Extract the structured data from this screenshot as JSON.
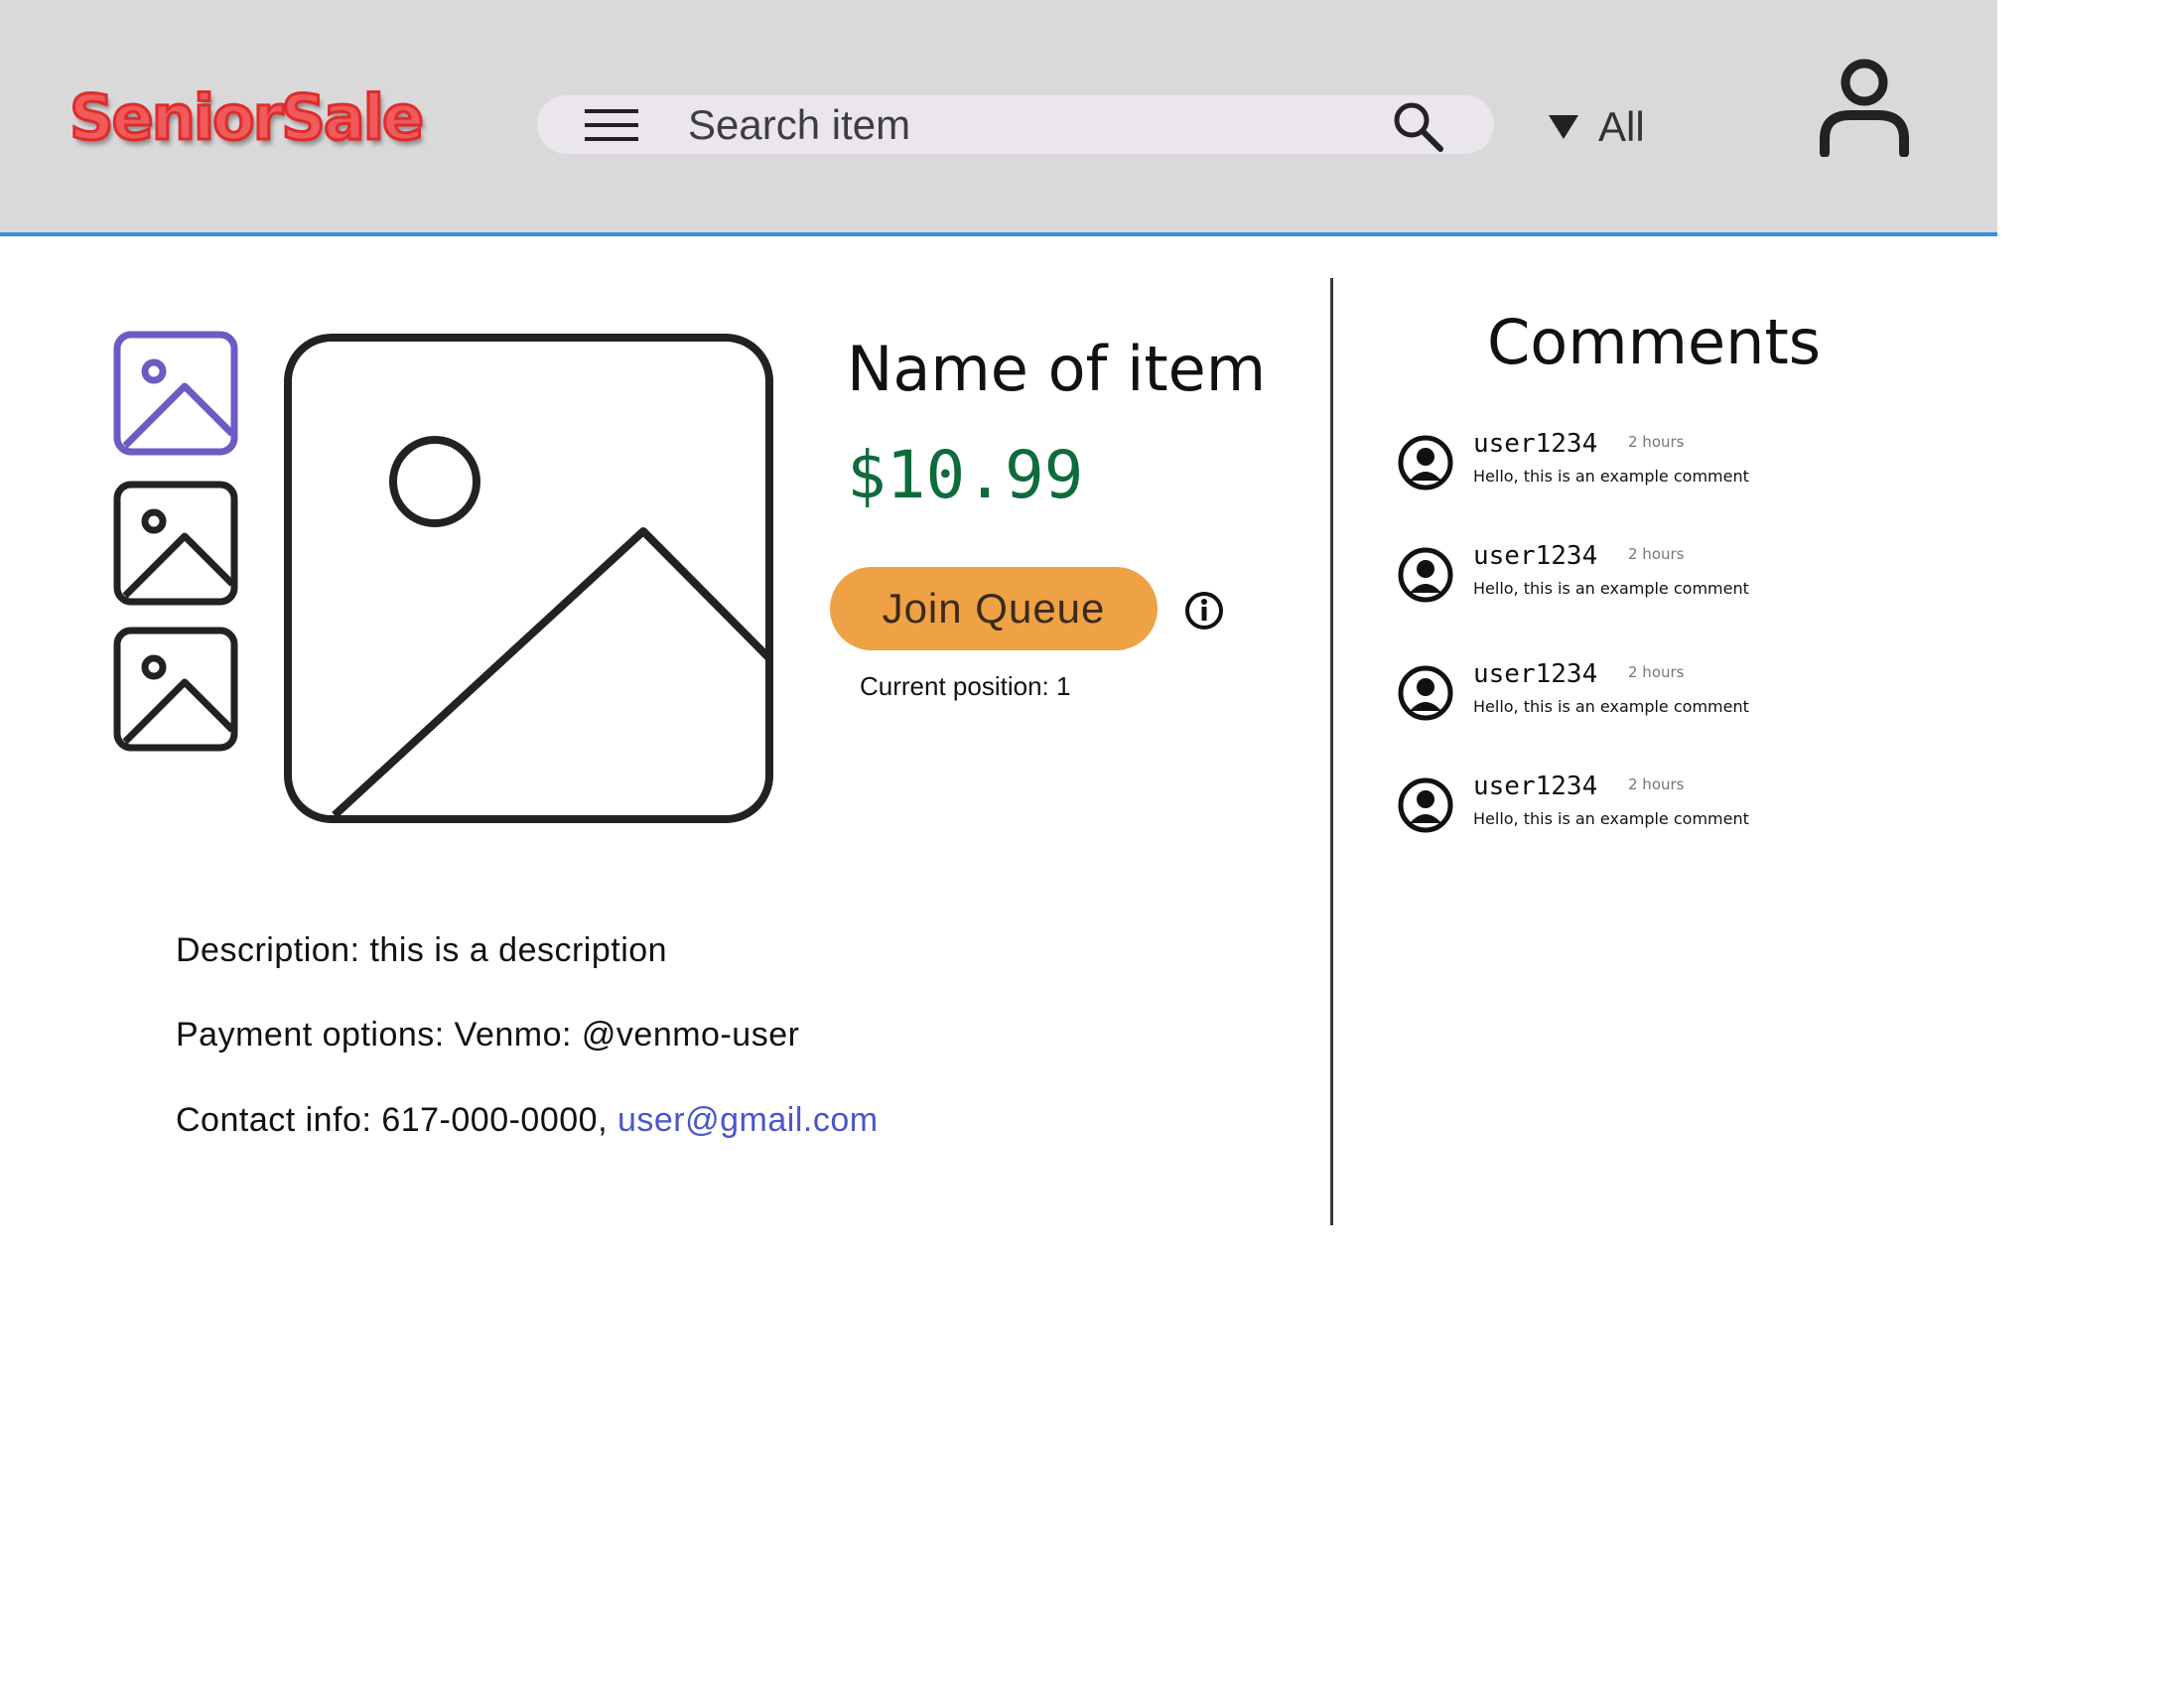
{
  "header": {
    "logo_text": "SeniorSale",
    "search_placeholder": "Search item",
    "filter_label": "All"
  },
  "item": {
    "name": "Name of item",
    "price": "$10.99",
    "join_button_label": "Join Queue",
    "queue_position": "Current position: 1",
    "description": "Description: this is a description",
    "payment": "Payment options: Venmo: @venmo-user",
    "contact_prefix": "Contact info: 617-000-0000, ",
    "contact_email": "user@gmail.com"
  },
  "comments": {
    "title": "Comments",
    "items": [
      {
        "user": "user1234",
        "time": "2 hours",
        "text": "Hello, this is an example comment"
      },
      {
        "user": "user1234",
        "time": "2 hours",
        "text": "Hello, this is an example comment"
      },
      {
        "user": "user1234",
        "time": "2 hours",
        "text": "Hello, this is an example comment"
      },
      {
        "user": "user1234",
        "time": "2 hours",
        "text": "Hello, this is an example comment"
      }
    ]
  },
  "colors": {
    "header_bg": "#d9d9d9",
    "header_border": "#3a8ee0",
    "logo": "#f05a5a",
    "price": "#0e6b3b",
    "join_button": "#efa145",
    "selected_thumbnail": "#6a5cc4",
    "link": "#4a56c8"
  },
  "icons": {
    "menu": "hamburger-menu-icon",
    "search": "search-icon",
    "filter": "caret-down-icon",
    "profile": "user-profile-icon",
    "thumbnail": "image-placeholder-icon",
    "info": "info-icon",
    "avatar": "user-avatar-icon"
  }
}
